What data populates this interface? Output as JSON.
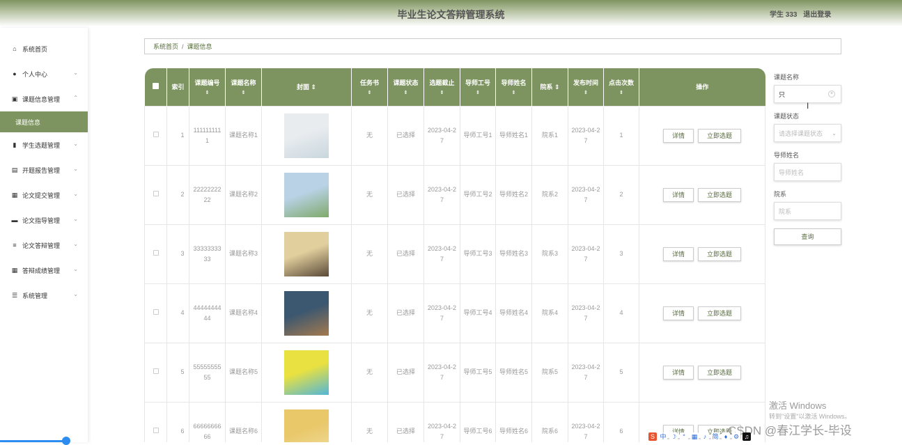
{
  "header": {
    "title": "毕业生论文答辩管理系统",
    "user": "学生 333",
    "logout": "退出登录"
  },
  "sidebar": {
    "items": [
      {
        "label": "系统首页",
        "icon": "home-icon",
        "chevron": ""
      },
      {
        "label": "个人中心",
        "icon": "user-icon",
        "chevron": "⌄"
      },
      {
        "label": "课题信息管理",
        "icon": "chart-icon",
        "chevron": "⌃"
      },
      {
        "label": "学生选题管理",
        "icon": "bar-chart-icon",
        "chevron": "⌄"
      },
      {
        "label": "开题报告管理",
        "icon": "clipboard-icon",
        "chevron": "⌄"
      },
      {
        "label": "论文提交管理",
        "icon": "grid-icon",
        "chevron": "⌄"
      },
      {
        "label": "论文指导管理",
        "icon": "briefcase-icon",
        "chevron": "⌄"
      },
      {
        "label": "论文答辩管理",
        "icon": "list-icon",
        "chevron": "⌄"
      },
      {
        "label": "答辩成绩管理",
        "icon": "grid-icon",
        "chevron": "⌄"
      },
      {
        "label": "系统管理",
        "icon": "sliders-icon",
        "chevron": "⌄"
      }
    ],
    "active_sub": "课题信息"
  },
  "breadcrumb": {
    "home": "系统首页",
    "sep": "/",
    "current": "课题信息"
  },
  "table": {
    "headers": [
      "索引",
      "课题编号",
      "课题名称",
      "封面",
      "任务书",
      "课题状态",
      "选题截止",
      "导师工号",
      "导师姓名",
      "院系",
      "发布时间",
      "点击次数",
      "操作"
    ],
    "rows": [
      {
        "index": "1",
        "code": "1111111111",
        "name": "课题名称1",
        "task": "无",
        "status": "已选择",
        "deadline": "2023-04-27",
        "tid": "导师工号1",
        "tname": "导师姓名1",
        "dept": "院系1",
        "pub": "2023-04-27",
        "clicks": "1"
      },
      {
        "index": "2",
        "code": "2222222222",
        "name": "课题名称2",
        "task": "无",
        "status": "已选择",
        "deadline": "2023-04-27",
        "tid": "导师工号2",
        "tname": "导师姓名2",
        "dept": "院系2",
        "pub": "2023-04-27",
        "clicks": "2"
      },
      {
        "index": "3",
        "code": "3333333333",
        "name": "课题名称3",
        "task": "无",
        "status": "已选择",
        "deadline": "2023-04-27",
        "tid": "导师工号3",
        "tname": "导师姓名3",
        "dept": "院系3",
        "pub": "2023-04-27",
        "clicks": "3"
      },
      {
        "index": "4",
        "code": "4444444444",
        "name": "课题名称4",
        "task": "无",
        "status": "已选择",
        "deadline": "2023-04-27",
        "tid": "导师工号4",
        "tname": "导师姓名4",
        "dept": "院系4",
        "pub": "2023-04-27",
        "clicks": "4"
      },
      {
        "index": "5",
        "code": "5555555555",
        "name": "课题名称5",
        "task": "无",
        "status": "已选择",
        "deadline": "2023-04-27",
        "tid": "导师工号5",
        "tname": "导师姓名5",
        "dept": "院系5",
        "pub": "2023-04-27",
        "clicks": "5"
      },
      {
        "index": "6",
        "code": "6666666666",
        "name": "课题名称6",
        "task": "无",
        "status": "已选择",
        "deadline": "2023-04-27",
        "tid": "导师工号6",
        "tname": "导师姓名6",
        "dept": "院系6",
        "pub": "2023-04-27",
        "clicks": "6"
      }
    ],
    "actions": {
      "detail": "详情",
      "select": "立即选题"
    }
  },
  "search": {
    "name_label": "课题名称",
    "name_value": "只",
    "status_label": "课题状态",
    "status_placeholder": "请选择课题状态",
    "teacher_label": "导师姓名",
    "teacher_placeholder": "导师姓名",
    "dept_label": "院系",
    "dept_placeholder": "院系",
    "query_button": "查询"
  },
  "overlay": {
    "activate_title": "激活 Windows",
    "activate_sub": "转到\"设置\"以激活 Windows。",
    "csdn": "CSDN @春江学长-毕设"
  },
  "colors": {
    "theme": "#7d9460",
    "accent": "#2d8cf0"
  }
}
